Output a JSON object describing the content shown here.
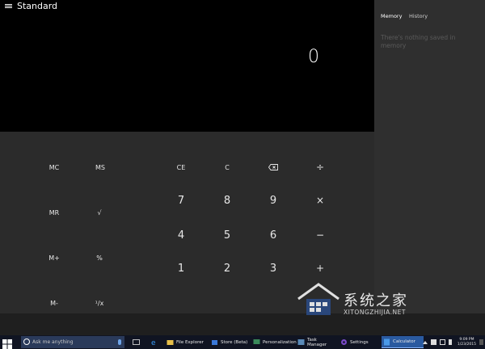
{
  "app": {
    "mode_title": "Standard",
    "display_value": "0"
  },
  "memory_row": [
    "MC",
    "MS"
  ],
  "keypad": {
    "row1": [
      "CE",
      "C",
      "⌫",
      "÷"
    ],
    "row2": [
      "MR",
      "√",
      "7",
      "8",
      "9",
      "×"
    ],
    "row3": [
      "4",
      "5",
      "6",
      "−"
    ],
    "row4": [
      "M+",
      "%",
      "1",
      "2",
      "3",
      "+"
    ],
    "row5": [
      "M-",
      "¹/x"
    ]
  },
  "side_panel": {
    "tabs": [
      "Memory",
      "History"
    ],
    "empty_message": "There's nothing saved in memory"
  },
  "watermark": {
    "cn": "系统之家",
    "en": "XITONGZHIJIA.NET"
  },
  "taskbar": {
    "search_placeholder": "Ask me anything",
    "items": [
      "File Explorer",
      "Store (Beta)",
      "Personalization",
      "Task Manager",
      "Settings",
      "Calculator"
    ],
    "time": "9:09 PM",
    "date": "1/23/2015"
  },
  "colors": {
    "display_bg": "#000000",
    "keypad_bg": "#2b2b2b",
    "side_panel_bg": "#2f2f2f",
    "taskbar_bg": "#101422",
    "taskbar_active": "#2a5aa0"
  }
}
